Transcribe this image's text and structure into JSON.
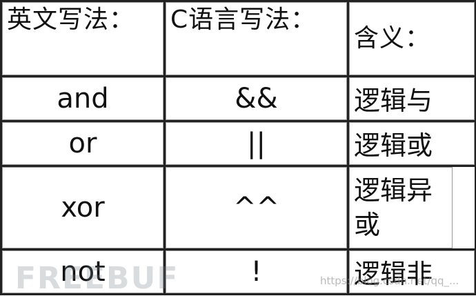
{
  "table": {
    "header": {
      "english": "英文写法：",
      "c_style": "C语言写法：",
      "meaning": "含义："
    },
    "rows": [
      {
        "english": "and",
        "c_style": "&&",
        "meaning": "逻辑与"
      },
      {
        "english": "or",
        "c_style": "||",
        "meaning": "逻辑或"
      },
      {
        "english": "xor",
        "c_style": "^^",
        "meaning": "逻辑异或"
      },
      {
        "english": "not",
        "c_style": "!",
        "meaning": "逻辑非"
      }
    ]
  },
  "watermark": {
    "logo_text": "FREEBUF",
    "url_text": "https://blog.csdn.net/qq_..."
  }
}
